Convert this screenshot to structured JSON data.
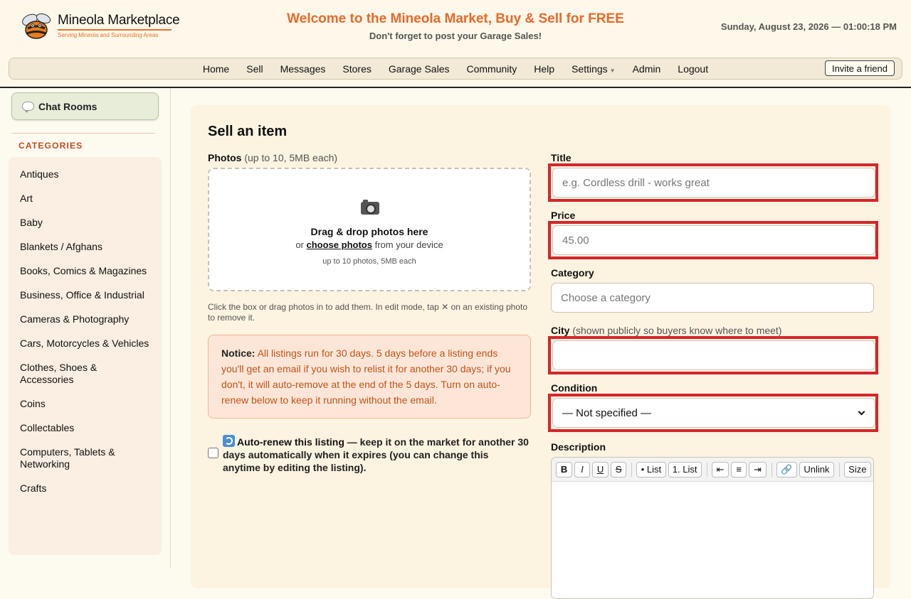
{
  "header": {
    "brand_name": "Mineola Marketplace",
    "brand_tagline": "Serving Mineola and Surrounding Areas",
    "welcome_title": "Welcome to the Mineola Market, Buy & Sell for FREE",
    "welcome_subtitle": "Don't forget to post your Garage Sales!",
    "datetime": "Sunday, August 23, 2026 — 01:00:18 PM",
    "accent_color": "#e8692b"
  },
  "nav": {
    "items": [
      "Home",
      "Sell",
      "Messages",
      "Stores",
      "Garage Sales",
      "Community",
      "Help",
      "Settings",
      "Admin",
      "Logout"
    ],
    "invite_label": "Invite a friend"
  },
  "sidebar": {
    "chat_label": "Chat Rooms",
    "categories_heading": "CATEGORIES",
    "categories": [
      "Antiques",
      "Art",
      "Baby",
      "Blankets / Afghans",
      "Books, Comics & Magazines",
      "Business, Office & Industrial",
      "Cameras & Photography",
      "Cars, Motorcycles & Vehicles",
      "Clothes, Shoes & Accessories",
      "Coins",
      "Collectables",
      "Computers, Tablets & Networking",
      "Crafts"
    ]
  },
  "form": {
    "page_title": "Sell an item",
    "photos_label": "Photos",
    "photos_hint": "(up to 10, 5MB each)",
    "dropzone_title": "Drag & drop photos here",
    "dropzone_or": "or",
    "dropzone_link": "choose photos",
    "dropzone_from": "from your device",
    "dropzone_limit": "up to 10 photos, 5MB each",
    "dropzone_help": "Click the box or drag photos in to add them. In edit mode, tap ✕ on an existing photo to remove it.",
    "notice_label": "Notice:",
    "notice_text": "All listings run for 30 days. 5 days before a listing ends you'll get an email if you wish to relist it for another 30 days; if you don't, it will auto-remove at the end of the 5 days. Turn on auto-renew below to keep it running without the email.",
    "autorenew_label": "Auto-renew this listing",
    "autorenew_text": "— keep it on the market for another 30 days automatically when it expires (you can change this anytime by editing the listing).",
    "title_label": "Title",
    "title_placeholder": "e.g. Cordless drill - works great",
    "price_label": "Price",
    "price_placeholder": "45.00",
    "category_label": "Category",
    "category_placeholder": "Choose a category",
    "city_label": "City",
    "city_hint": "(shown publicly so buyers know where to meet)",
    "city_value": "",
    "condition_label": "Condition",
    "condition_value": "— Not specified —",
    "description_label": "Description",
    "toolbar": {
      "bold": "B",
      "italic": "I",
      "underline": "U",
      "strike": "S",
      "bullet_list": "• List",
      "number_list": "1. List",
      "outdent": "⇤",
      "align": "≡",
      "indent": "⇥",
      "link": "🔗",
      "unlink": "Unlink",
      "size": "Size"
    },
    "highlight_color": "#d4262a"
  }
}
